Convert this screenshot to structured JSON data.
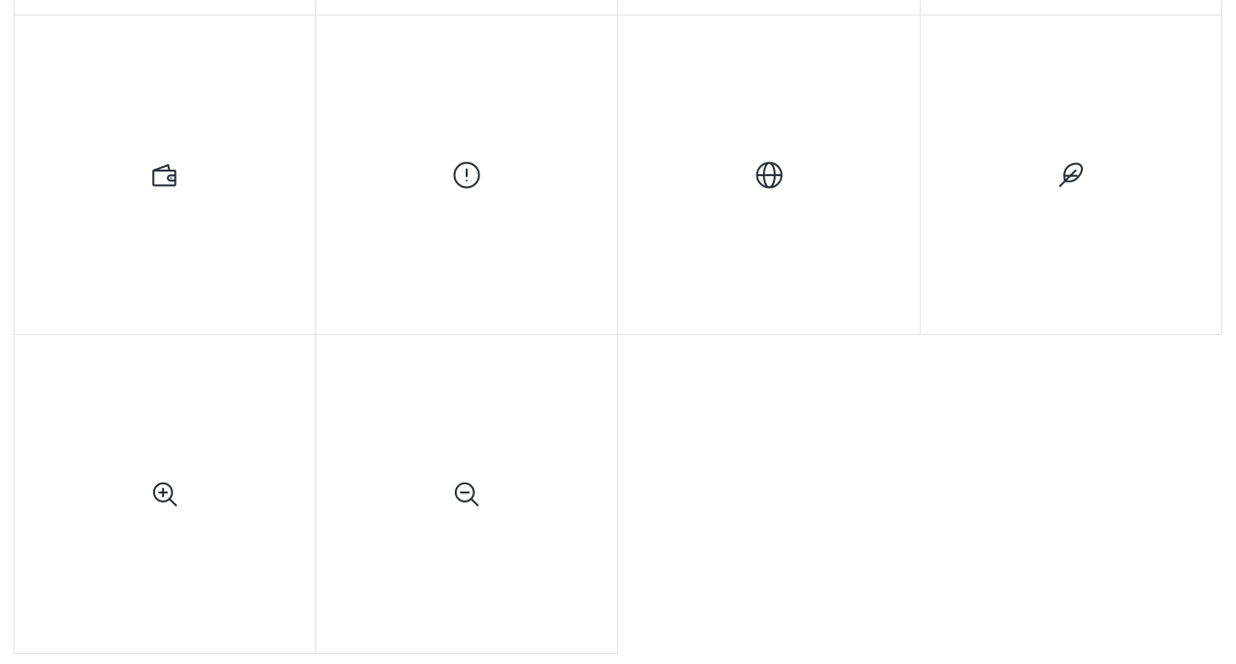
{
  "grid": {
    "border_color": "#e3e3e6",
    "icon_color": "#2a2f36",
    "top_row_partial": [
      {
        "icon": "unknown-icon"
      },
      {
        "icon": "unknown-icon"
      },
      {
        "icon": "unknown-icon"
      },
      {
        "icon": "unknown-icon"
      }
    ],
    "rows": [
      [
        {
          "icon": "wallet-icon"
        },
        {
          "icon": "alert-circle-icon"
        },
        {
          "icon": "globe-icon"
        },
        {
          "icon": "feather-icon"
        }
      ],
      [
        {
          "icon": "zoom-in-icon"
        },
        {
          "icon": "zoom-out-icon"
        }
      ]
    ]
  }
}
